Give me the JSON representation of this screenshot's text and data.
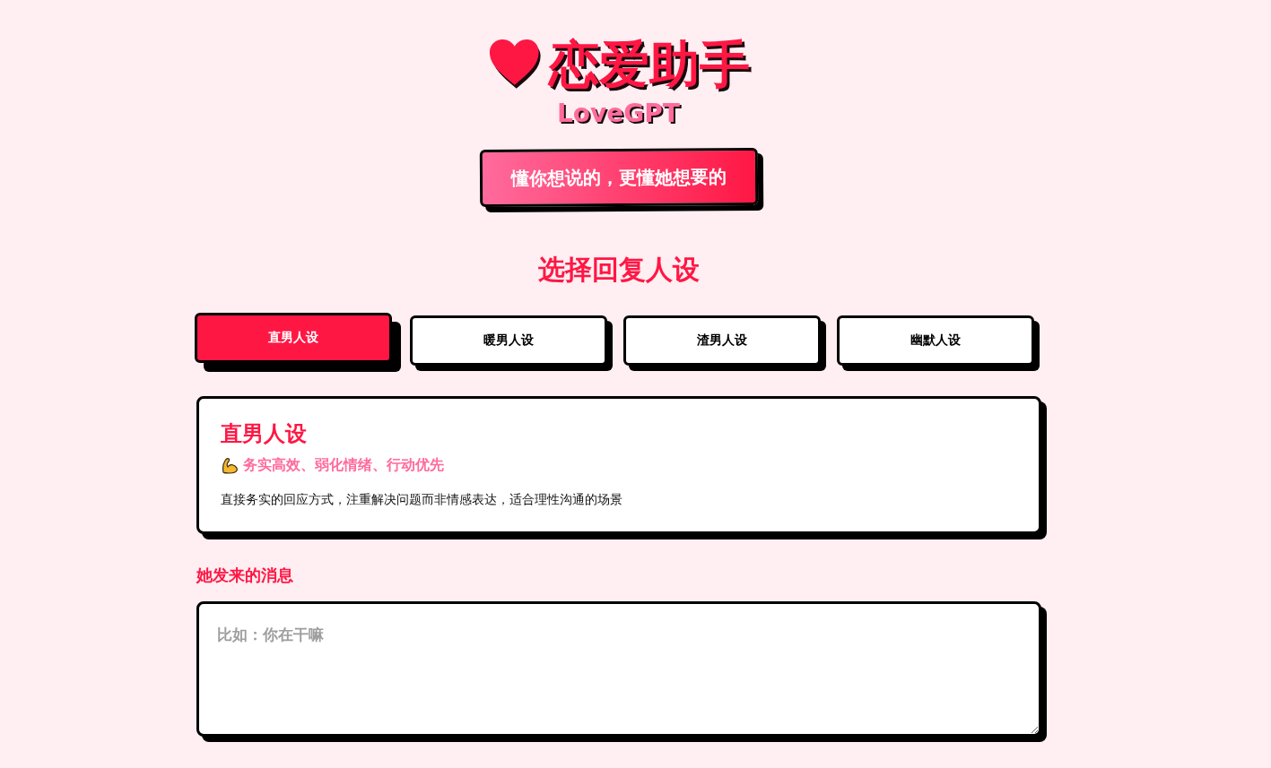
{
  "header": {
    "title": "恋爱助手",
    "subtitle": "LoveGPT",
    "tagline": "懂你想说的，更懂她想要的"
  },
  "persona_section": {
    "heading": "选择回复人设",
    "tabs": [
      {
        "label": "直男人设",
        "selected": true
      },
      {
        "label": "暖男人设",
        "selected": false
      },
      {
        "label": "渣男人设",
        "selected": false
      },
      {
        "label": "幽默人设",
        "selected": false
      }
    ]
  },
  "persona_card": {
    "title": "直男人设",
    "traits": "务实高效、弱化情绪、行动优先",
    "description": "直接务实的回应方式，注重解决问题而非情感表达，适合理性沟通的场景"
  },
  "message_input": {
    "label": "她发来的消息",
    "placeholder": "比如：你在干嘛"
  }
}
